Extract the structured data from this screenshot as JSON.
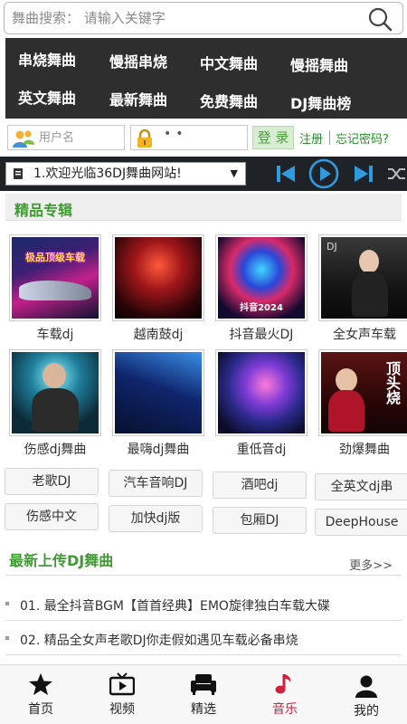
{
  "search": {
    "label": "舞曲搜索：",
    "placeholder": "请输入关键字"
  },
  "categories": [
    "串烧舞曲",
    "慢摇串烧",
    "中文舞曲",
    "慢摇舞曲",
    "英文舞曲",
    "最新舞曲",
    "免费舞曲",
    "DJ舞曲榜"
  ],
  "login": {
    "username_placeholder": "用户名",
    "password_value": "••",
    "login_button": "登 录",
    "register": "注册",
    "forgot": "忘记密码?"
  },
  "player": {
    "current_track": "1.欢迎光临36DJ舞曲网站!"
  },
  "featured": {
    "title": "精品专辑",
    "albums": [
      "车载dj",
      "越南鼓dj",
      "抖音最火DJ",
      "全女声车载",
      "伤感dj舞曲",
      "最嗨dj舞曲",
      "重低音dj",
      "劲爆舞曲"
    ],
    "tags": [
      "老歌DJ",
      "汽车音响DJ",
      "酒吧dj",
      "全英文dj串",
      "伤感中文",
      "加快dj版",
      "包厢DJ",
      "DeepHouse"
    ]
  },
  "latest": {
    "title": "最新上传DJ舞曲",
    "more": "更多>>",
    "items": [
      "01. 最全抖音BGM【首首经典】EMO旋律独白车载大碟",
      "02. 精品全女声老歌DJ你走假如遇见车载必备串烧"
    ]
  },
  "cover_text": {
    "album1": "极品顶级车载",
    "album3": "抖音2024",
    "album4": "DJ",
    "album8": "顶头烧"
  },
  "tabbar": {
    "items": [
      {
        "label": "首页",
        "icon": "star-icon"
      },
      {
        "label": "视频",
        "icon": "tv-icon"
      },
      {
        "label": "精选",
        "icon": "sofa-icon"
      },
      {
        "label": "音乐",
        "icon": "music-note-icon"
      },
      {
        "label": "我的",
        "icon": "user-icon"
      }
    ],
    "active": "音乐"
  },
  "colors": {
    "accent_green": "#3f9a32",
    "nav_bg": "#2e2e2e",
    "active_tab": "#d0213d",
    "player_blue": "#2f9be0"
  }
}
